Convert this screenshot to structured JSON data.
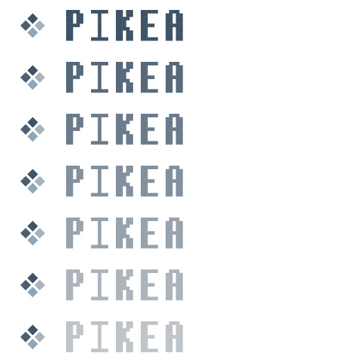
{
  "logo": {
    "wordmark": "PIKEA",
    "emblem_colors": {
      "top": "#3f5367",
      "left": "#4d6073",
      "right": "#a8b3bd",
      "bottom": "#8ca7ba",
      "outline": "#ffffff"
    }
  },
  "variants": [
    {
      "text_color": "#3f5366"
    },
    {
      "text_color": "#56697b"
    },
    {
      "text_color": "#6b7b8b"
    },
    {
      "text_color": "#828f9c"
    },
    {
      "text_color": "#98a2ac"
    },
    {
      "text_color": "#acb3ba"
    },
    {
      "text_color": "#bfc4c9"
    }
  ]
}
